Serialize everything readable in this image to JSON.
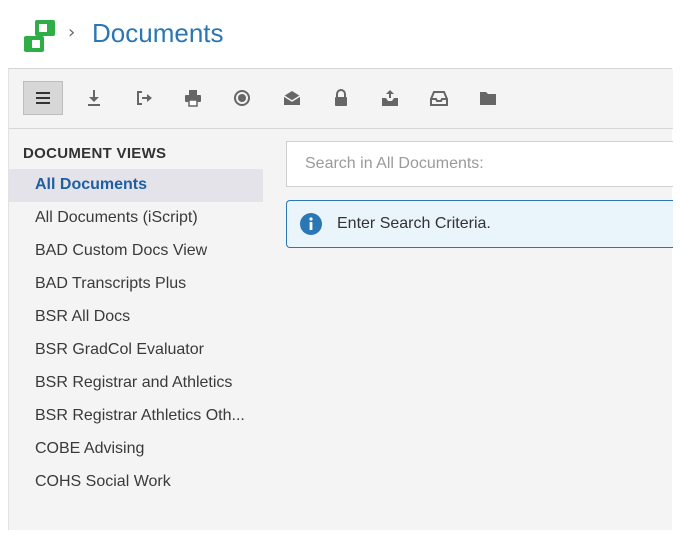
{
  "header": {
    "logo_icon": "app-logo-icon",
    "breadcrumb_separator": "›",
    "title": "Documents",
    "title_color": "#2a77b5"
  },
  "toolbar": {
    "buttons": [
      {
        "name": "menu",
        "icon": "hamburger-menu-icon",
        "active": true
      },
      {
        "name": "download",
        "icon": "download-icon"
      },
      {
        "name": "export",
        "icon": "export-icon"
      },
      {
        "name": "print",
        "icon": "print-icon"
      },
      {
        "name": "record",
        "icon": "record-icon"
      },
      {
        "name": "mail",
        "icon": "open-envelope-icon"
      },
      {
        "name": "lock",
        "icon": "lock-icon"
      },
      {
        "name": "upload",
        "icon": "inbox-upload-icon"
      },
      {
        "name": "inbox",
        "icon": "inbox-icon"
      },
      {
        "name": "folder",
        "icon": "folder-icon"
      }
    ]
  },
  "sidebar": {
    "heading": "DOCUMENT VIEWS",
    "items": [
      {
        "label": "All Documents",
        "selected": true
      },
      {
        "label": "All Documents (iScript)"
      },
      {
        "label": "BAD Custom Docs View"
      },
      {
        "label": "BAD Transcripts Plus"
      },
      {
        "label": "BSR All Docs"
      },
      {
        "label": "BSR GradCol Evaluator"
      },
      {
        "label": "BSR Registrar and Athletics"
      },
      {
        "label": "BSR Registrar Athletics Oth..."
      },
      {
        "label": "COBE Advising"
      },
      {
        "label": "COHS Social Work"
      }
    ]
  },
  "search": {
    "placeholder": "Search in All Documents:",
    "value": ""
  },
  "info": {
    "icon": "info-icon",
    "message": "Enter Search Criteria.",
    "accent": "#2a77b5"
  }
}
